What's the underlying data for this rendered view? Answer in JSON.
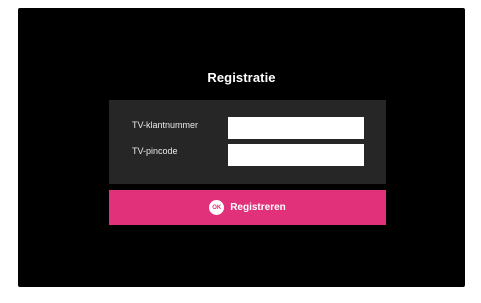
{
  "page": {
    "title": "Registratie"
  },
  "form": {
    "customer_number_label": "TV-klantnummer",
    "customer_number_value": "",
    "pincode_label": "TV-pincode",
    "pincode_value": ""
  },
  "register_button": {
    "icon_text": "OK",
    "icon": "ok-icon",
    "label": "Registreren"
  },
  "colors": {
    "background": "#000000",
    "panel": "#262626",
    "accent": "#e0317a"
  }
}
